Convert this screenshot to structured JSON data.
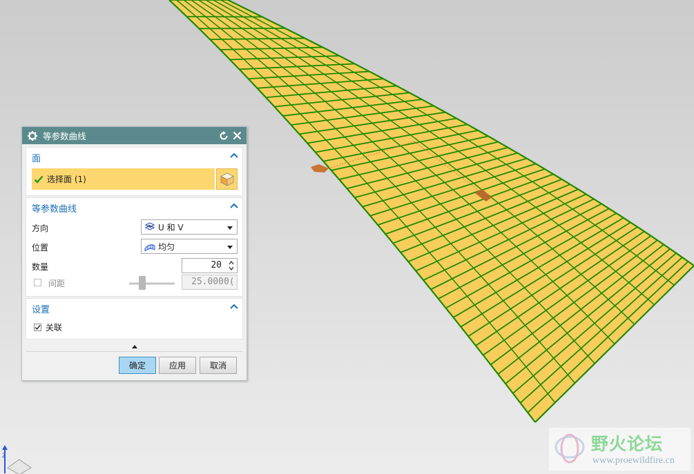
{
  "dialog": {
    "title": "等参数曲线",
    "face_section": {
      "header": "面",
      "select_label": "选择面 (1)"
    },
    "iso_section": {
      "header": "等参数曲线",
      "direction_label": "方向",
      "direction_value": "U 和 V",
      "position_label": "位置",
      "position_value": "均匀",
      "count_label": "数量",
      "count_value": "20",
      "spacing_label": "间距",
      "spacing_value": "25.0000(",
      "spacing_checked": false
    },
    "settings_section": {
      "header": "设置",
      "associative_label": "关联",
      "associative_checked": true
    },
    "buttons": {
      "ok": "确定",
      "apply": "应用",
      "cancel": "取消"
    }
  },
  "watermark": {
    "title": "野火论坛",
    "url": "www.proewildfire.cn"
  },
  "colors": {
    "surface_fill": "#f7cd5c",
    "surface_grid": "#1f8a00",
    "title_bar": "#5b8a8d",
    "section_header": "#1c70b6",
    "selection_highlight": "#fcd76f"
  }
}
